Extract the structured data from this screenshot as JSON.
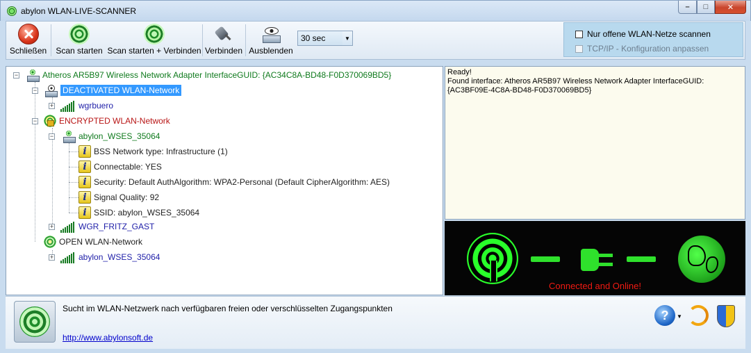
{
  "window": {
    "title": "abylon WLAN-LIVE-SCANNER",
    "controls": {
      "minimize": "–",
      "maximize": "□",
      "close": "✕"
    }
  },
  "toolbar": {
    "close_label": "Schließen",
    "scan_label": "Scan starten",
    "scan_connect_label": "Scan starten + Verbinden",
    "connect_label": "Verbinden",
    "hide_label": "Ausblenden",
    "interval": {
      "selected": "30 sec"
    },
    "options": {
      "open_only": {
        "label": "Nur offene WLAN-Netze scannen",
        "checked": false,
        "enabled": true
      },
      "tcpip": {
        "label": "TCP/IP - Konfiguration anpassen",
        "checked": false,
        "enabled": false
      }
    }
  },
  "tree": {
    "adapter": "Atheros AR5B97 Wireless Network Adapter InterfaceGUID: {AC34C8A-BD48-F0D370069BD5}",
    "deactivated": {
      "label": "DEACTIVATED WLAN-Network",
      "networks": [
        "wgrbuero"
      ]
    },
    "encrypted": {
      "label": "ENCRYPTED WLAN-Network",
      "networks": [
        {
          "name": "abylon_WSES_35064",
          "details": [
            "BSS Network type: Infrastructure (1)",
            "Connectable: YES",
            "Security: Default AuthAlgorithm: WPA2-Personal (Default CipherAlgorithm: AES)",
            "Signal Quality: 92",
            "SSID: abylon_WSES_35064"
          ]
        },
        {
          "name": "WGR_FRITZ_GAST"
        }
      ]
    },
    "open": {
      "label": "OPEN WLAN-Network",
      "networks": [
        "abylon_WSES_35064"
      ]
    }
  },
  "log": {
    "lines": [
      "Ready!",
      "Found interface: Atheros AR5B97 Wireless Network Adapter InterfaceGUID: {AC3BF09E-4C8A-BD48-F0D370069BD5}"
    ]
  },
  "status": {
    "text": "Connected and Online!",
    "color": "#f01a12",
    "accent": "#29ff2a"
  },
  "footer": {
    "description": "Sucht im WLAN-Netzwerk nach verfügbaren freien oder verschlüsselten Zugangspunkten",
    "link": "http://www.abylonsoft.de",
    "help_icon_glyph": "?"
  },
  "icons": {
    "app": "radar-icon",
    "close": "close-circle-icon",
    "scan": "radar-scan-icon",
    "connect": "plug-icon",
    "hide": "eye-hide-icon",
    "help": "help-icon",
    "refresh": "refresh-icon",
    "shield": "uac-shield-icon"
  }
}
